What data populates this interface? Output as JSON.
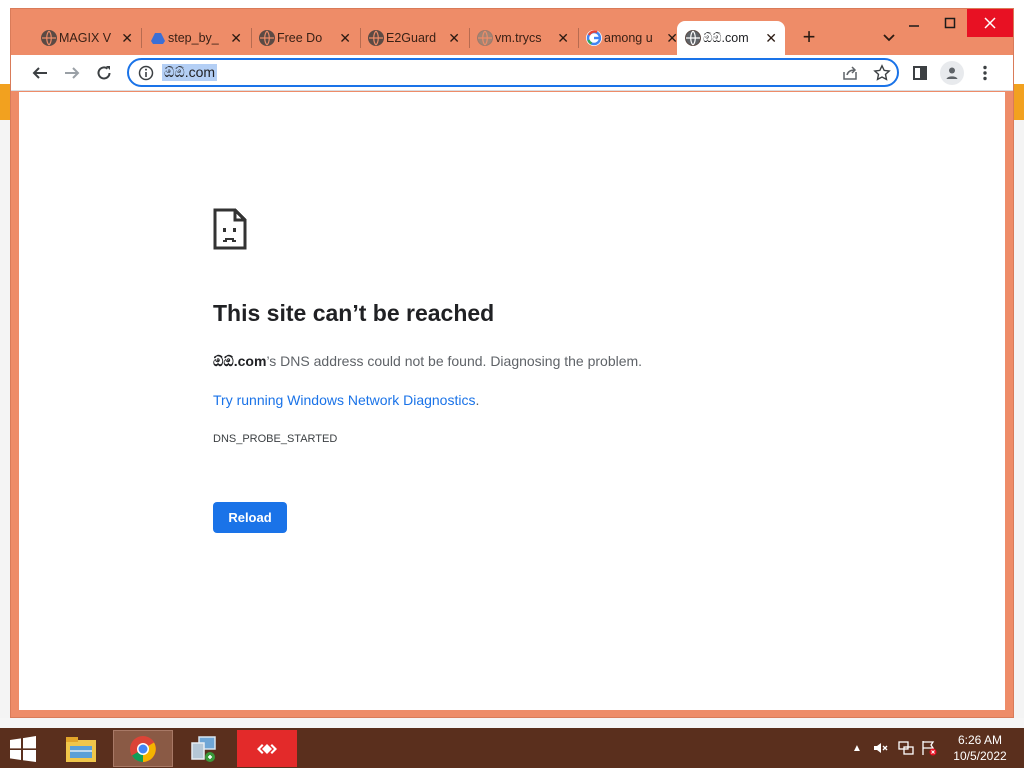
{
  "window": {
    "minimize_label": "🗕",
    "maximize_label": "🗖",
    "close_label": "✕"
  },
  "tabs": [
    {
      "title": "MAGIX V",
      "icon": "globe-icon"
    },
    {
      "title": "step_by_",
      "icon": "drive-icon"
    },
    {
      "title": "Free Do",
      "icon": "globe-icon"
    },
    {
      "title": "E2Guard",
      "icon": "globe-icon"
    },
    {
      "title": "vm.trycs",
      "icon": "globe-icon"
    },
    {
      "title": "among u",
      "icon": "google-icon"
    },
    {
      "title": "ඕඕ.com",
      "icon": "globe-icon",
      "active": true
    }
  ],
  "tab_close": "✕",
  "new_tab": "+",
  "omnibox": {
    "url": "ඕඕ.com"
  },
  "error": {
    "title": "This site can’t be reached",
    "domain": "ඕඕ.com",
    "desc_rest": "’s DNS address could not be found. Diagnosing the problem.",
    "link": "Try running Windows Network Diagnostics",
    "link_suffix": ".",
    "code": "DNS_PROBE_STARTED",
    "reload": "Reload"
  },
  "clock": {
    "time": "6:26 AM",
    "date": "10/5/2022"
  },
  "colors": {
    "frame": "#ee8c68",
    "accent": "#1a73e8",
    "taskbar": "#5a2f1d"
  }
}
